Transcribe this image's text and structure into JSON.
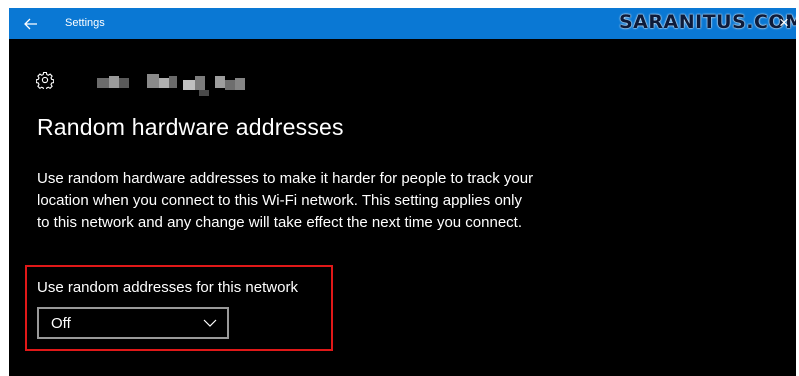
{
  "titlebar": {
    "title": "Settings",
    "back_icon": "arrow-left-icon",
    "close_icon": "close-icon",
    "background": "#0a78d4"
  },
  "watermark": {
    "text": "SARANITUS.COM"
  },
  "page": {
    "icon": "gear-icon",
    "heading": "Random hardware addresses",
    "description": "Use random hardware addresses to make it harder for people to track your location when you connect to this Wi-Fi network. This setting applies only to this network and any change will take effect the next time you connect."
  },
  "setting": {
    "label": "Use random addresses for this network",
    "selected_value": "Off",
    "highlight_color": "#e01818"
  }
}
